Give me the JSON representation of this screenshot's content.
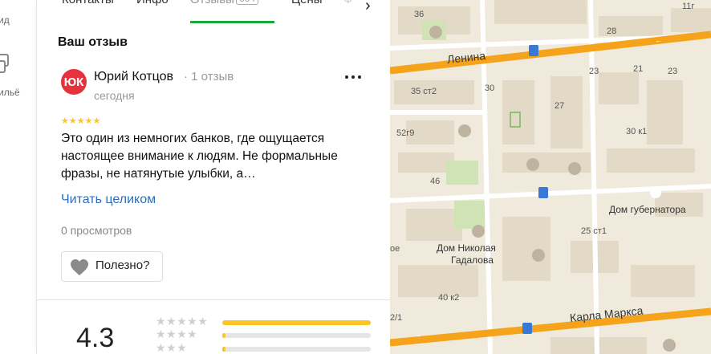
{
  "rail": {
    "items": [
      {
        "label": "ид",
        "icon": "guide-icon"
      },
      {
        "label": "ильё",
        "icon": "housing-icon"
      }
    ]
  },
  "tabs": {
    "items": [
      {
        "label": "Контакты"
      },
      {
        "label": "Инфо"
      },
      {
        "label": "Отзывы",
        "count": "664",
        "active": true
      },
      {
        "label": "Цены"
      },
      {
        "label": "Ф"
      }
    ],
    "next_icon": "chevron-right-icon"
  },
  "review": {
    "section_title": "Ваш отзыв",
    "avatar_initials": "ЮК",
    "author": "Юрий Котцов",
    "author_reviews": "1 отзыв",
    "date": "сегодня",
    "rating": 5,
    "stars": "★★★★★",
    "text": "Это один из немногих банков, где ощущается настоящее внимание к людям. Не формальные фразы, не натянутые улыбки, а…",
    "read_more": "Читать целиком",
    "views": "0 просмотров",
    "useful_label": "Полезно?"
  },
  "rating_summary": {
    "value": "4.3",
    "distribution": [
      {
        "stars": "★★★★★",
        "fraction": 1.0
      },
      {
        "stars": "★★★★",
        "fraction": 0.02
      },
      {
        "stars": "★★★",
        "fraction": 0.02
      }
    ]
  },
  "map": {
    "streets": [
      "Ленина",
      "Карла Маркса"
    ],
    "places": [
      "Дом губернатора",
      "Дом Николая",
      "Гадалова"
    ],
    "house_numbers": [
      "36",
      "28",
      "23",
      "21",
      "23",
      "35 ст2",
      "30",
      "27",
      "52г9",
      "30 к1",
      "46",
      "25 ст1",
      "40 к2",
      "11г",
      "оe",
      "2/1"
    ],
    "colors": {
      "road": "#f5a31a",
      "background": "#efeadb",
      "block": "#e0d8c4",
      "park": "#cfe3b5",
      "transit": "#3a78d6"
    }
  }
}
